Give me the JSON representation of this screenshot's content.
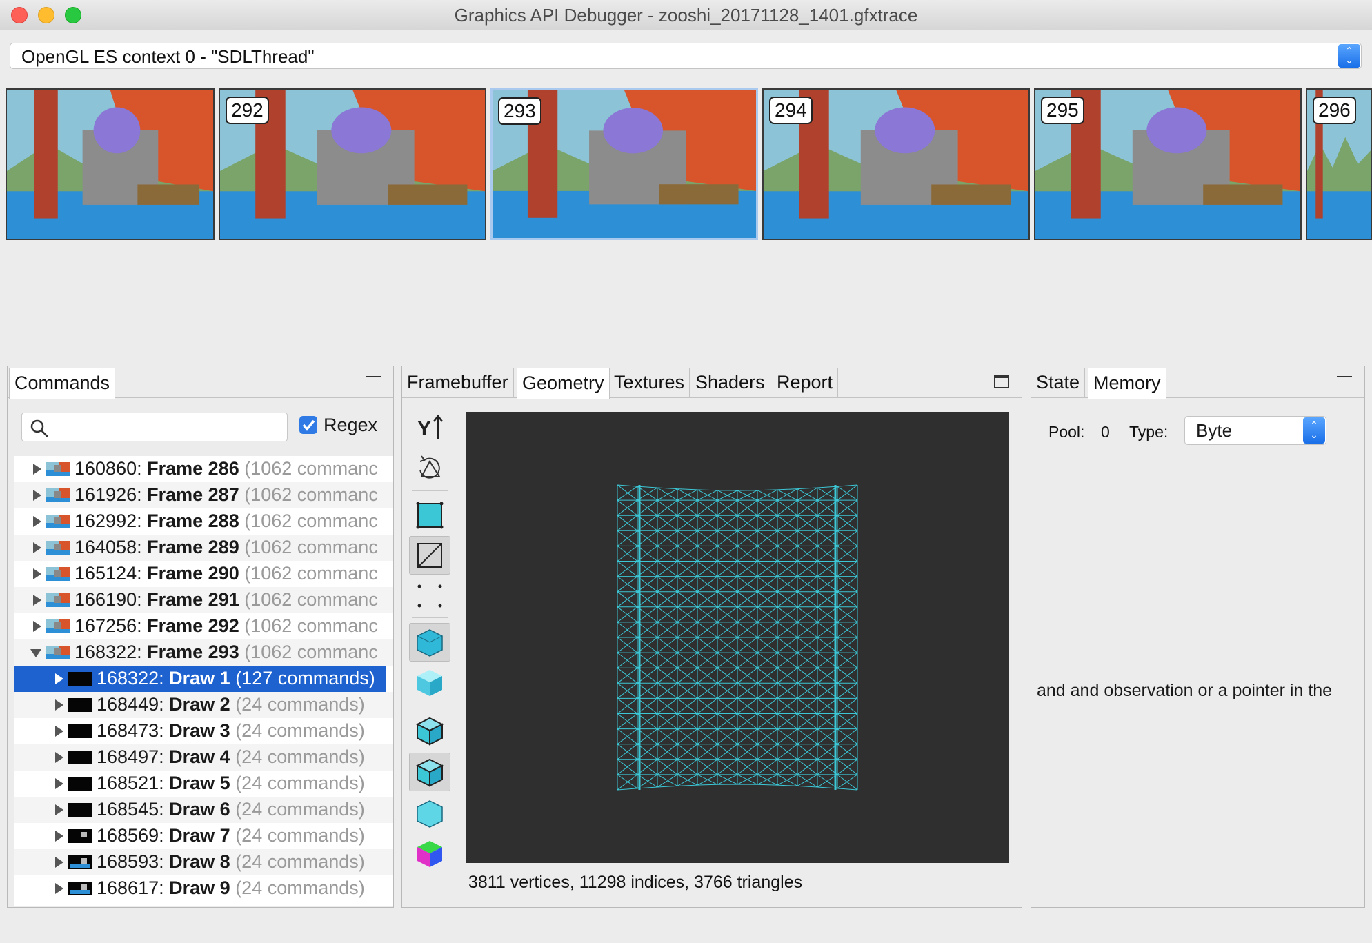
{
  "window": {
    "title": "Graphics API Debugger - zooshi_20171128_1401.gfxtrace",
    "colors": {
      "close": "#fe5f57",
      "minimize": "#febc2e",
      "zoom": "#28c840"
    }
  },
  "context_selector": {
    "value": "OpenGL ES context 0 - \"SDLThread\""
  },
  "filmstrip": {
    "frames": [
      {
        "label": ""
      },
      {
        "label": "292"
      },
      {
        "label": "293"
      },
      {
        "label": "294"
      },
      {
        "label": "295"
      },
      {
        "label": "296"
      }
    ],
    "selected_label": "293"
  },
  "commands_panel": {
    "tab_label": "Commands",
    "search": {
      "value": "",
      "placeholder": ""
    },
    "regex": {
      "label": "Regex",
      "checked": true
    },
    "rows": [
      {
        "id": "160860:",
        "name": "Frame 286",
        "count": "(1062 commanc"
      },
      {
        "id": "161926:",
        "name": "Frame 287",
        "count": "(1062 commanc"
      },
      {
        "id": "162992:",
        "name": "Frame 288",
        "count": "(1062 commanc"
      },
      {
        "id": "164058:",
        "name": "Frame 289",
        "count": "(1062 commanc"
      },
      {
        "id": "165124:",
        "name": "Frame 290",
        "count": "(1062 commanc"
      },
      {
        "id": "166190:",
        "name": "Frame 291",
        "count": "(1062 commanc"
      },
      {
        "id": "167256:",
        "name": "Frame 292",
        "count": "(1062 commanc"
      },
      {
        "id": "168322:",
        "name": "Frame 293",
        "count": "(1062 commanc"
      },
      {
        "id": "168322:",
        "name": "Draw 1",
        "count": "(127 commands)"
      },
      {
        "id": "168449:",
        "name": "Draw 2",
        "count": "(24 commands)"
      },
      {
        "id": "168473:",
        "name": "Draw 3",
        "count": "(24 commands)"
      },
      {
        "id": "168497:",
        "name": "Draw 4",
        "count": "(24 commands)"
      },
      {
        "id": "168521:",
        "name": "Draw 5",
        "count": "(24 commands)"
      },
      {
        "id": "168545:",
        "name": "Draw 6",
        "count": "(24 commands)"
      },
      {
        "id": "168569:",
        "name": "Draw 7",
        "count": "(24 commands)"
      },
      {
        "id": "168593:",
        "name": "Draw 8",
        "count": "(24 commands)"
      },
      {
        "id": "168617:",
        "name": "Draw 9",
        "count": "(24 commands)"
      }
    ]
  },
  "center_panel": {
    "tabs": [
      "Framebuffer",
      "Geometry",
      "Textures",
      "Shaders",
      "Report"
    ],
    "active_tab": "Geometry",
    "tools": [
      "y-up-icon",
      "rotate-icon",
      "solid-quad-icon",
      "wireframe-quad-icon",
      "points-icon",
      "smooth-shading-icon",
      "flat-shading-icon",
      "wireframe-cube-icon",
      "textured-cube-icon",
      "lit-cube-icon",
      "color-cube-icon"
    ],
    "mesh_color": "#3cc7d6",
    "status": "3811 vertices, 11298 indices, 3766 triangles"
  },
  "right_panel": {
    "tabs": [
      "State",
      "Memory"
    ],
    "active_tab": "Memory",
    "pool_label": "Pool:",
    "pool_value": "0",
    "type_label": "Type:",
    "type_value": "Byte",
    "message": "and and observation or a pointer in the"
  }
}
